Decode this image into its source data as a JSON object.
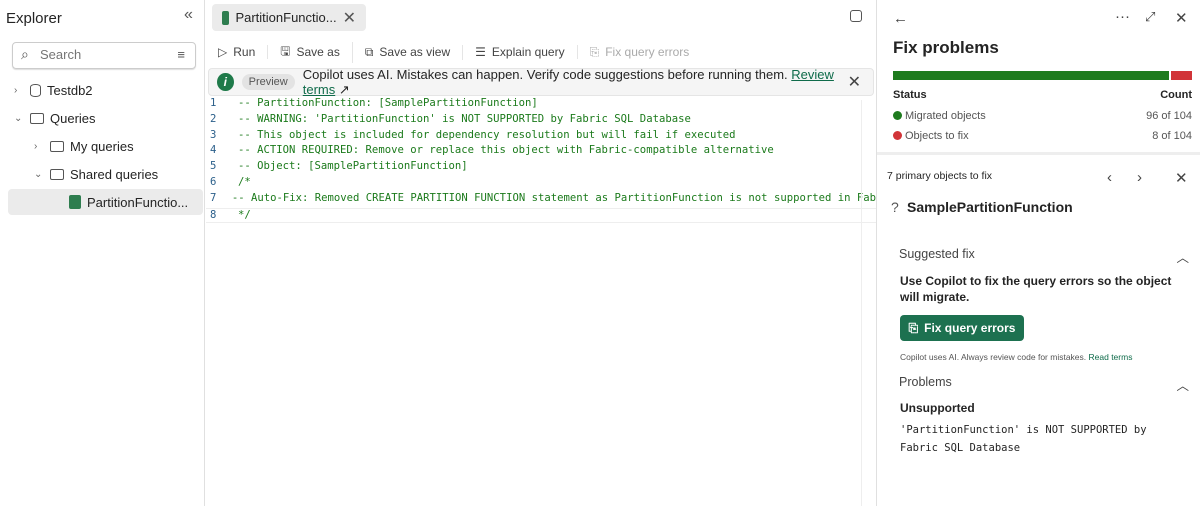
{
  "explorer": {
    "title": "Explorer",
    "search_placeholder": "Search",
    "tree": [
      {
        "label": "Testdb2"
      },
      {
        "label": "Queries"
      },
      {
        "label": "My queries"
      },
      {
        "label": "Shared queries"
      },
      {
        "label": "PartitionFunctio..."
      }
    ]
  },
  "tab": {
    "label": "PartitionFunctio..."
  },
  "toolbar": {
    "run": "Run",
    "save_as": "Save as",
    "save_as_view": "Save as view",
    "explain": "Explain query",
    "fix": "Fix query errors"
  },
  "banner": {
    "badge": "Preview",
    "text": "Copilot uses AI. Mistakes can happen. Verify code suggestions before running them.",
    "link": "Review terms"
  },
  "code": [
    {
      "n": "1",
      "t": "-- PartitionFunction: [SamplePartitionFunction]"
    },
    {
      "n": "2",
      "t": "-- WARNING: 'PartitionFunction' is NOT SUPPORTED by Fabric SQL Database"
    },
    {
      "n": "3",
      "t": "-- This object is included for dependency resolution but will fail if executed"
    },
    {
      "n": "4",
      "t": "-- ACTION REQUIRED: Remove or replace this object with Fabric-compatible alternative"
    },
    {
      "n": "5",
      "t": "-- Object: [SamplePartitionFunction]"
    },
    {
      "n": "6",
      "t": "/*"
    },
    {
      "n": "7",
      "t": "-- Auto-Fix: Removed CREATE PARTITION FUNCTION statement as PartitionFunction is not supported in Fab"
    },
    {
      "n": "8",
      "t": "*/"
    }
  ],
  "panel": {
    "title": "Fix problems",
    "status_header": "Status",
    "count_header": "Count",
    "migrated": {
      "label": "Migrated objects",
      "count": "96 of 104",
      "value": 96,
      "color": "#1e7b1e"
    },
    "to_fix": {
      "label": "Objects to fix",
      "count": "8 of 104",
      "value": 8,
      "color": "#d13438"
    },
    "primary": "7 primary objects to fix",
    "object": "SamplePartitionFunction",
    "suggested": "Suggested fix",
    "suggest_text": "Use Copilot to fix the query errors so the object will migrate.",
    "fix_button": "Fix query errors",
    "disclaimer": "Copilot uses AI. Always review code for mistakes.",
    "read_terms": "Read terms",
    "problems": "Problems",
    "problem_type": "Unsupported",
    "problem_text": "'PartitionFunction' is NOT SUPPORTED by Fabric SQL Database"
  }
}
